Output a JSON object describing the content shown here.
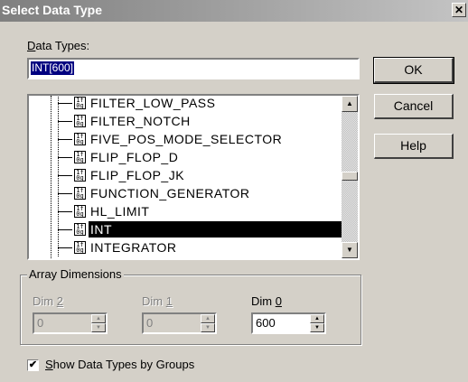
{
  "window": {
    "title": "Select Data Type",
    "close_glyph": "✕"
  },
  "data_types": {
    "label_hotkey": "D",
    "label_rest": "ata Types:",
    "value": "INT[600]"
  },
  "buttons": {
    "ok": "OK",
    "cancel": "Cancel",
    "help": "Help"
  },
  "tree": {
    "items": [
      {
        "label": "FILTER_LOW_PASS",
        "selected": false
      },
      {
        "label": "FILTER_NOTCH",
        "selected": false
      },
      {
        "label": "FIVE_POS_MODE_SELECTOR",
        "selected": false
      },
      {
        "label": "FLIP_FLOP_D",
        "selected": false
      },
      {
        "label": "FLIP_FLOP_JK",
        "selected": false
      },
      {
        "label": "FUNCTION_GENERATOR",
        "selected": false
      },
      {
        "label": "HL_LIMIT",
        "selected": false
      },
      {
        "label": "INT",
        "selected": true
      },
      {
        "label": "INTEGRATOR",
        "selected": false
      }
    ],
    "icon": "data-type-icon"
  },
  "array_dimensions": {
    "title": "Array Dimensions",
    "dims": [
      {
        "label_prefix": "Dim ",
        "label_hotkey": "2",
        "value": "0",
        "enabled": false
      },
      {
        "label_prefix": "Dim ",
        "label_hotkey": "1",
        "value": "0",
        "enabled": false
      },
      {
        "label_prefix": "Dim ",
        "label_hotkey": "0",
        "value": "600",
        "enabled": true
      }
    ]
  },
  "show_groups": {
    "checked": true,
    "check_glyph": "✔",
    "label_hotkey": "S",
    "label_rest": "how Data Types by Groups"
  },
  "colors": {
    "selection": "#000000",
    "input_highlight": "#000080",
    "face": "#d4d0c8"
  }
}
